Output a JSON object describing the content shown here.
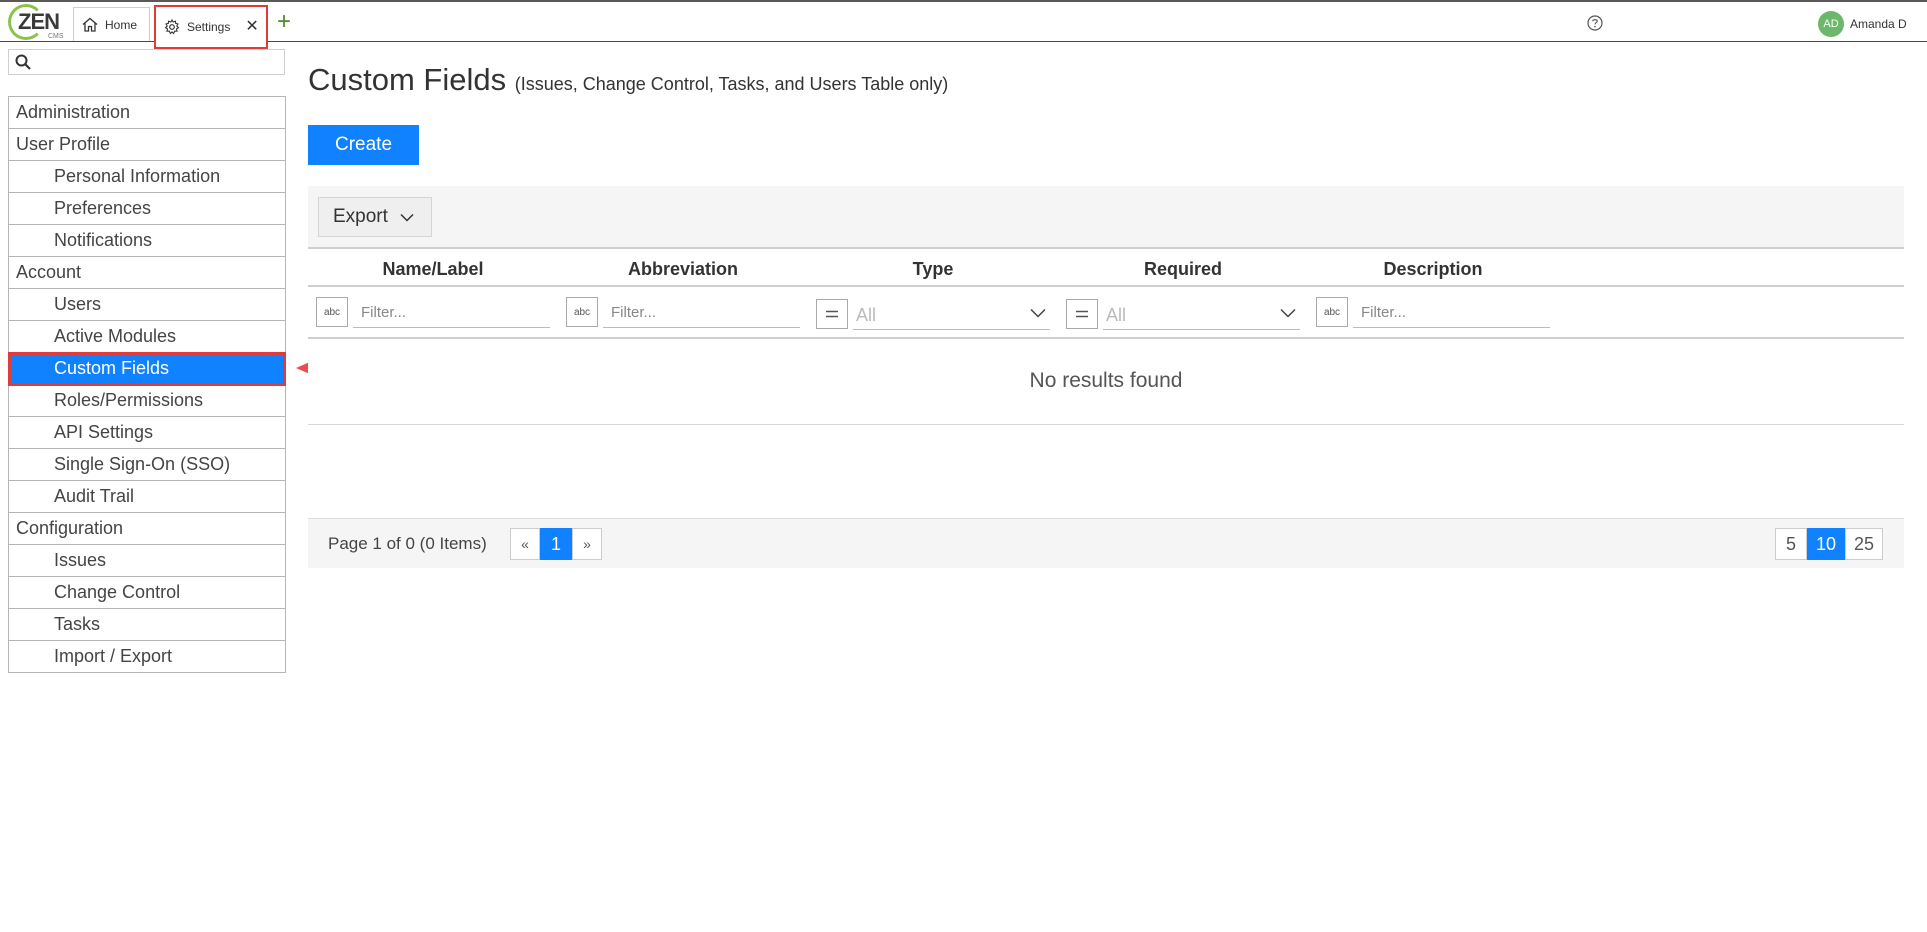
{
  "app": {
    "logo_text": "ZEN",
    "logo_sub": "CMS",
    "tabs": [
      {
        "label": "Home",
        "icon": "home-icon"
      },
      {
        "label": "Settings",
        "icon": "gear-icon",
        "close": "✕"
      }
    ],
    "add_tab": "+",
    "user": {
      "initials": "AD",
      "name": "Amanda D"
    }
  },
  "sidebar": {
    "search_placeholder": "",
    "items": [
      {
        "label": "Administration",
        "level": "group"
      },
      {
        "label": "User Profile",
        "level": "group"
      },
      {
        "label": "Personal Information",
        "level": "child"
      },
      {
        "label": "Preferences",
        "level": "child"
      },
      {
        "label": "Notifications",
        "level": "child"
      },
      {
        "label": "Account",
        "level": "group"
      },
      {
        "label": "Users",
        "level": "child"
      },
      {
        "label": "Active Modules",
        "level": "child"
      },
      {
        "label": "Custom Fields",
        "level": "child",
        "active": true
      },
      {
        "label": "Roles/Permissions",
        "level": "child"
      },
      {
        "label": "API Settings",
        "level": "child"
      },
      {
        "label": "Single Sign-On (SSO)",
        "level": "child"
      },
      {
        "label": "Audit Trail",
        "level": "child"
      },
      {
        "label": "Configuration",
        "level": "group"
      },
      {
        "label": "Issues",
        "level": "child"
      },
      {
        "label": "Change Control",
        "level": "child"
      },
      {
        "label": "Tasks",
        "level": "child"
      },
      {
        "label": "Import / Export",
        "level": "child"
      }
    ]
  },
  "main": {
    "title": "Custom Fields",
    "subtitle": "(Issues, Change Control, Tasks, and Users Table only)",
    "create_label": "Create",
    "export_label": "Export",
    "columns": [
      "Name/Label",
      "Abbreviation",
      "Type",
      "Required",
      "Description"
    ],
    "filters": {
      "text_placeholder": "Filter...",
      "select_value": "All",
      "text_filter_icon": "abc"
    },
    "empty_message": "No results found",
    "pager": {
      "info": "Page 1 of 0 (0 Items)",
      "prev": "«",
      "current_page": "1",
      "next": "»",
      "page_sizes": [
        "5",
        "10",
        "25"
      ],
      "active_size": "10"
    }
  },
  "colors": {
    "accent": "#1081ff",
    "highlight": "#e03b3b",
    "logo_green": "#8bc34a"
  }
}
